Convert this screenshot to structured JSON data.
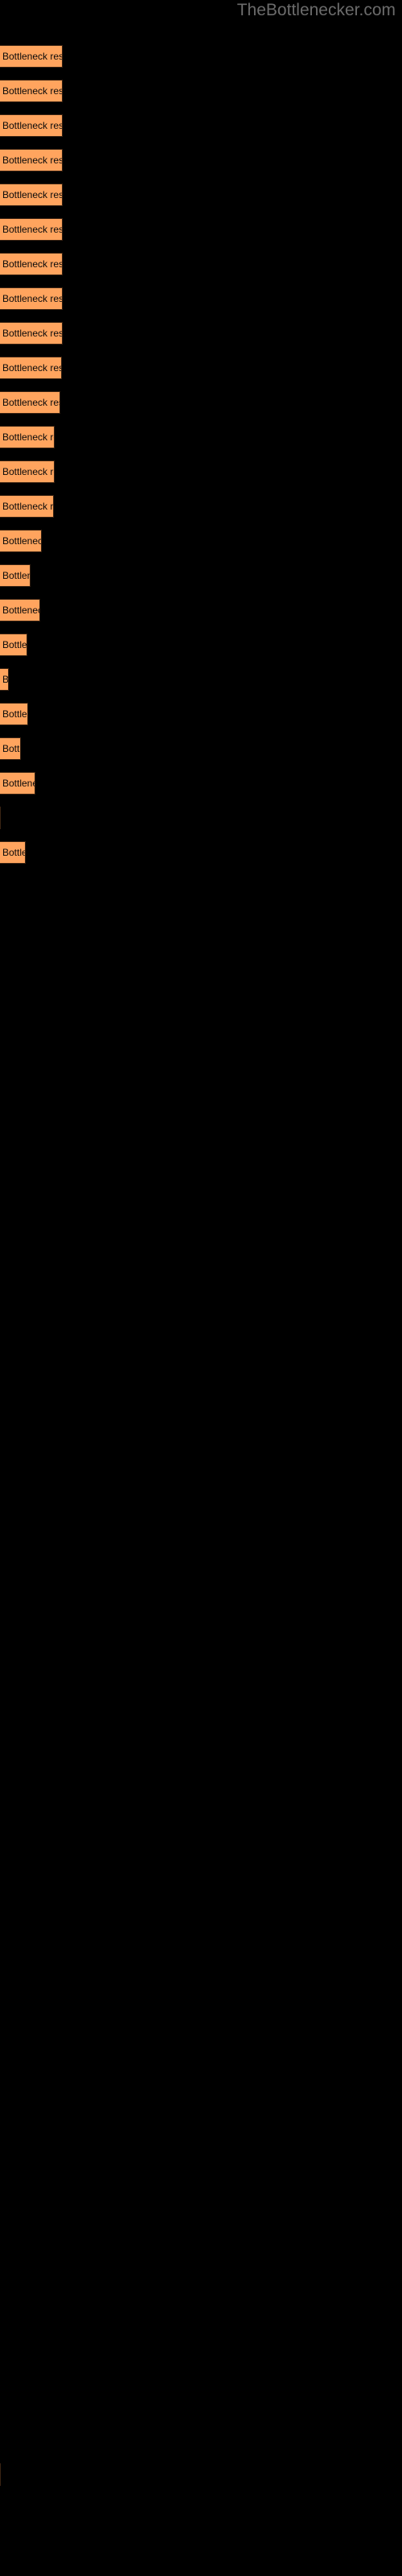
{
  "header": {
    "site_title": "TheBottlenecker.com"
  },
  "colors": {
    "background": "#000000",
    "bar_fill": "#ffa45e",
    "bar_border": "#3a2312",
    "bar_label_text": "#0a0a0a",
    "title_text": "#6b6b6b"
  },
  "chart_data": {
    "type": "bar",
    "orientation": "horizontal",
    "title": "TheBottlenecker.com",
    "xlabel": "",
    "ylabel": "",
    "grid": false,
    "legend": false,
    "bar_label_text": "Bottleneck result",
    "xlim": [
      0,
      80
    ],
    "categories": [
      "Bottleneck result",
      "Bottleneck result",
      "Bottleneck result",
      "Bottleneck result",
      "Bottleneck result",
      "Bottleneck result",
      "Bottleneck result",
      "Bottleneck result",
      "Bottleneck result",
      "Bottleneck result",
      "Bottleneck result",
      "Bottleneck result",
      "Bottleneck result",
      "Bottleneck result",
      "Bottleneck result",
      "Bottleneck result",
      "Bottleneck result",
      "Bottleneck result",
      "Bottleneck result",
      "Bottleneck result",
      "Bottleneck result",
      "Bottleneck result",
      "Bottleneck result",
      "Bottleneck result",
      "Bottleneck result"
    ],
    "values": [
      78,
      78,
      78,
      78,
      78,
      78,
      78,
      78,
      78,
      76,
      72,
      66,
      66,
      64,
      51,
      38,
      49,
      34,
      11,
      34,
      25,
      43,
      1,
      33,
      1
    ],
    "bars": [
      {
        "y": 56,
        "width": 78,
        "label": "Bottleneck result"
      },
      {
        "y": 99,
        "width": 78,
        "label": "Bottleneck result"
      },
      {
        "y": 142,
        "width": 78,
        "label": "Bottleneck result"
      },
      {
        "y": 185,
        "width": 78,
        "label": "Bottleneck result"
      },
      {
        "y": 228,
        "width": 78,
        "label": "Bottleneck result"
      },
      {
        "y": 271,
        "width": 78,
        "label": "Bottleneck result"
      },
      {
        "y": 314,
        "width": 78,
        "label": "Bottleneck result"
      },
      {
        "y": 357,
        "width": 78,
        "label": "Bottleneck result"
      },
      {
        "y": 400,
        "width": 78,
        "label": "Bottleneck result"
      },
      {
        "y": 443,
        "width": 77,
        "label": "Bottleneck result"
      },
      {
        "y": 486,
        "width": 75,
        "label": "Bottleneck result"
      },
      {
        "y": 529,
        "width": 68,
        "label": "Bottleneck result"
      },
      {
        "y": 572,
        "width": 68,
        "label": "Bottleneck result"
      },
      {
        "y": 615,
        "width": 67,
        "label": "Bottleneck result"
      },
      {
        "y": 658,
        "width": 52,
        "label": "Bottleneck"
      },
      {
        "y": 701,
        "width": 38,
        "label": "Bottle"
      },
      {
        "y": 744,
        "width": 50,
        "label": "Bottlenec"
      },
      {
        "y": 787,
        "width": 34,
        "label": "Bott"
      },
      {
        "y": 830,
        "width": 11,
        "label": "B"
      },
      {
        "y": 873,
        "width": 35,
        "label": "Bottl"
      },
      {
        "y": 916,
        "width": 26,
        "label": "Bo"
      },
      {
        "y": 959,
        "width": 44,
        "label": "Bottler"
      },
      {
        "y": 1002,
        "width": 1,
        "label": ""
      },
      {
        "y": 1045,
        "width": 32,
        "label": "Bott"
      },
      {
        "y": 3060,
        "width": 1,
        "label": ""
      }
    ]
  }
}
